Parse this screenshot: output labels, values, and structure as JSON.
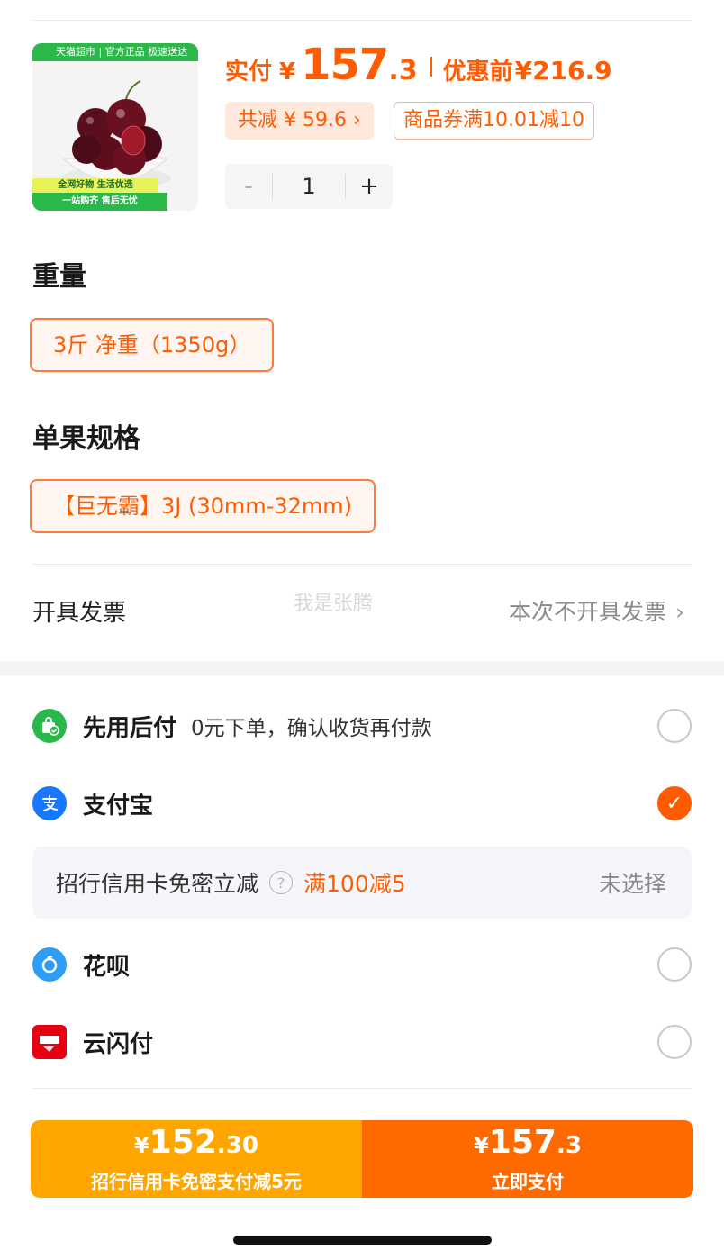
{
  "product": {
    "image_banner": "天猫超市 | 官方正品 极速送达",
    "image_tag_1": "全网好物 生活优选",
    "image_tag_2": "一站购齐 售后无忧",
    "pay_label": "实付",
    "currency": "¥",
    "pay_int": "157",
    "pay_dec": ".3",
    "pre_label": "优惠前",
    "pre_value": "¥216.9",
    "saved_tag": "共减 ¥ 59.6 ›",
    "coupon_tag": "商品券满10.01减10",
    "quantity": "1",
    "minus": "-",
    "plus": "+"
  },
  "weight": {
    "title": "重量",
    "selected": "3斤 净重（1350g）"
  },
  "spec": {
    "title": "单果规格",
    "selected": "【巨无霸】3J (30mm-32mm)"
  },
  "invoice": {
    "label": "开具发票",
    "value": "本次不开具发票",
    "chevron": "›"
  },
  "watermark": "我是张腾",
  "payment_methods": [
    {
      "name": "先用后付",
      "desc": "0元下单，确认收货再付款",
      "icon": "bag-check-icon",
      "color": "#2bb84a",
      "checked": false
    },
    {
      "name": "支付宝",
      "desc": "",
      "icon": "alipay-icon",
      "color": "#1677ff",
      "checked": true
    },
    {
      "name": "花呗",
      "desc": "",
      "icon": "huabei-icon",
      "color": "#2f9df3",
      "checked": false
    },
    {
      "name": "云闪付",
      "desc": "",
      "icon": "unionpay-quickpass-icon",
      "color": "#e60012",
      "checked": false
    }
  ],
  "promo": {
    "label": "招行信用卡免密立减",
    "help": "?",
    "deal": "满100减5",
    "status": "未选择"
  },
  "pay_bar": {
    "left_currency": "¥",
    "left_int": "152",
    "left_dec": ".30",
    "left_sub": "招行信用卡免密支付减5元",
    "right_currency": "¥",
    "right_int": "157",
    "right_dec": ".3",
    "right_sub": "立即支付"
  },
  "colors": {
    "accent": "#ff5b00",
    "pay_left": "#ffa500",
    "pay_right": "#ff6a00"
  }
}
